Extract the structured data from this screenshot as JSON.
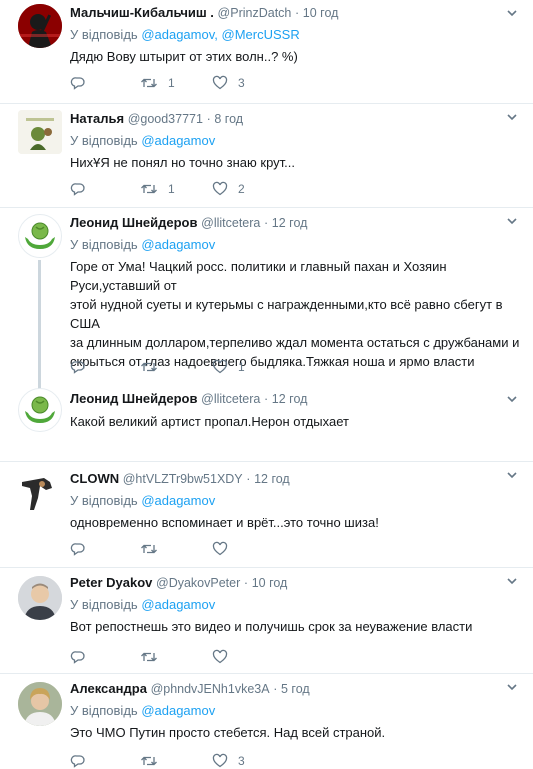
{
  "replying_label": "У відповідь",
  "tweets": [
    {
      "name": "Мальчиш-Кибальчиш .",
      "handle": "@PrinzDatch",
      "time": "10 год",
      "reply_to": [
        "@adagamov,",
        "@MercUSSR"
      ],
      "text": "Дядю Вову штырит от этих волн..? %)",
      "replies": "",
      "retweets": "1",
      "likes": "3"
    },
    {
      "name": "Наталья",
      "handle": "@good37771",
      "time": "8 год",
      "reply_to": [
        "@adagamov"
      ],
      "text": "НихҰЯ не понял но точно знаю крут...",
      "replies": "",
      "retweets": "1",
      "likes": "2"
    },
    {
      "name": "Леонид Шнейдеров",
      "handle": "@llitcetera",
      "time": "12 год",
      "reply_to": [
        "@adagamov"
      ],
      "text_lines": [
        "Горе от Ума! Чацкий росс. политики и главный пахан и Хозяин",
        "Руси,уставший от",
        "этой нудной суеты и кутерьмы с награжденными,кто всё равно сбегут в США",
        "за длинным долларом,терпеливо ждал момента остаться с дружбанами и",
        "скрыться от глаз надоевшего быдляка.Тяжкая ноша и ярмо власти"
      ],
      "replies": "",
      "retweets": "",
      "likes": "1"
    },
    {
      "name": "Леонид Шнейдеров",
      "handle": "@llitcetera",
      "time": "12 год",
      "text": "Какой великий артист пропал.Нерон отдыхает"
    },
    {
      "name": "CLOWN",
      "handle": "@htVLZTr9bw51XDY",
      "time": "12 год",
      "reply_to": [
        "@adagamov"
      ],
      "text": "одновременно вспоминает и врёт...это точно шиза!",
      "replies": "",
      "retweets": "",
      "likes": ""
    },
    {
      "name": "Peter Dyakov",
      "handle": "@DyakovPeter",
      "time": "10 год",
      "reply_to": [
        "@adagamov"
      ],
      "text": "Вот репостнешь это видео и получишь срок за неуважение власти",
      "replies": "",
      "retweets": "",
      "likes": ""
    },
    {
      "name": "Александра",
      "handle": "@phndvJENh1vke3A",
      "time": "5 год",
      "reply_to": [
        "@adagamov"
      ],
      "text": "Это ЧМО Путин просто стебется. Над всей страной.",
      "replies": "",
      "retweets": "",
      "likes": "3"
    }
  ],
  "colors": {
    "text": "#14171a",
    "secondary": "#657786",
    "link": "#1da1f2",
    "divider": "#e6ecf0",
    "thread_line": "#ccd6dd"
  },
  "icons": [
    "reply-icon",
    "retweet-icon",
    "like-icon",
    "chevron-down-icon"
  ]
}
